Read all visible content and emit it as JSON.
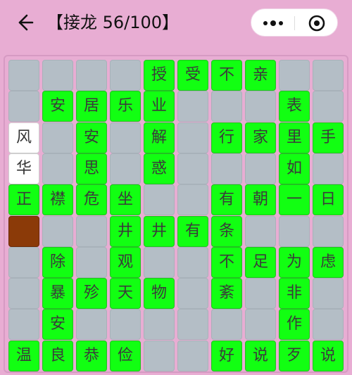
{
  "header": {
    "title": "【接龙 56/100】",
    "back_icon": "arrow-left-icon",
    "more_icon": "more-dots-icon",
    "close_icon": "target-circle-icon"
  },
  "colors": {
    "background": "#e8add3",
    "filled": "#12ff12",
    "empty": "#b4bec6",
    "selected": "#8b3a08",
    "option": "#ffffff"
  },
  "board": {
    "rows": [
      [
        "",
        "",
        "",
        "",
        "授",
        "受",
        "不",
        "亲",
        "",
        ""
      ],
      [
        "",
        "安",
        "居",
        "乐",
        "业",
        "",
        "",
        "",
        "表",
        ""
      ],
      [
        "风",
        "",
        "安",
        "",
        "解",
        "",
        "行",
        "家",
        "里",
        "手"
      ],
      [
        "华",
        "",
        "思",
        "",
        "惑",
        "",
        "",
        "",
        "如",
        ""
      ],
      [
        "正",
        "襟",
        "危",
        "坐",
        "",
        "",
        "有",
        "朝",
        "一",
        "日"
      ],
      [
        "",
        "",
        "",
        "井",
        "井",
        "有",
        "条",
        "",
        "",
        ""
      ],
      [
        "",
        "除",
        "",
        "观",
        "",
        "",
        "不",
        "足",
        "为",
        "虑"
      ],
      [
        "",
        "暴",
        "殄",
        "天",
        "物",
        "",
        "紊",
        "",
        "非",
        ""
      ],
      [
        "",
        "安",
        "",
        "",
        "",
        "",
        "",
        "",
        "作",
        ""
      ],
      [
        "温",
        "良",
        "恭",
        "俭",
        "",
        "",
        "好",
        "说",
        "歹",
        "说"
      ]
    ],
    "states": [
      [
        "empty",
        "empty",
        "empty",
        "empty",
        "filled",
        "filled",
        "filled",
        "filled",
        "empty",
        "empty"
      ],
      [
        "empty",
        "filled",
        "filled",
        "filled",
        "filled",
        "empty",
        "empty",
        "empty",
        "filled",
        "empty"
      ],
      [
        "option",
        "empty",
        "filled",
        "empty",
        "filled",
        "empty",
        "filled",
        "filled",
        "filled",
        "filled"
      ],
      [
        "option",
        "empty",
        "filled",
        "empty",
        "filled",
        "empty",
        "empty",
        "empty",
        "filled",
        "empty"
      ],
      [
        "filled",
        "filled",
        "filled",
        "filled",
        "empty",
        "empty",
        "filled",
        "filled",
        "filled",
        "filled"
      ],
      [
        "selected",
        "empty",
        "empty",
        "filled",
        "filled",
        "filled",
        "filled",
        "empty",
        "empty",
        "empty"
      ],
      [
        "empty",
        "filled",
        "empty",
        "filled",
        "empty",
        "empty",
        "filled",
        "filled",
        "filled",
        "filled"
      ],
      [
        "empty",
        "filled",
        "filled",
        "filled",
        "filled",
        "empty",
        "filled",
        "empty",
        "filled",
        "empty"
      ],
      [
        "empty",
        "filled",
        "empty",
        "empty",
        "empty",
        "empty",
        "empty",
        "empty",
        "filled",
        "empty"
      ],
      [
        "filled",
        "filled",
        "filled",
        "filled",
        "empty",
        "empty",
        "filled",
        "filled",
        "filled",
        "filled"
      ]
    ]
  }
}
